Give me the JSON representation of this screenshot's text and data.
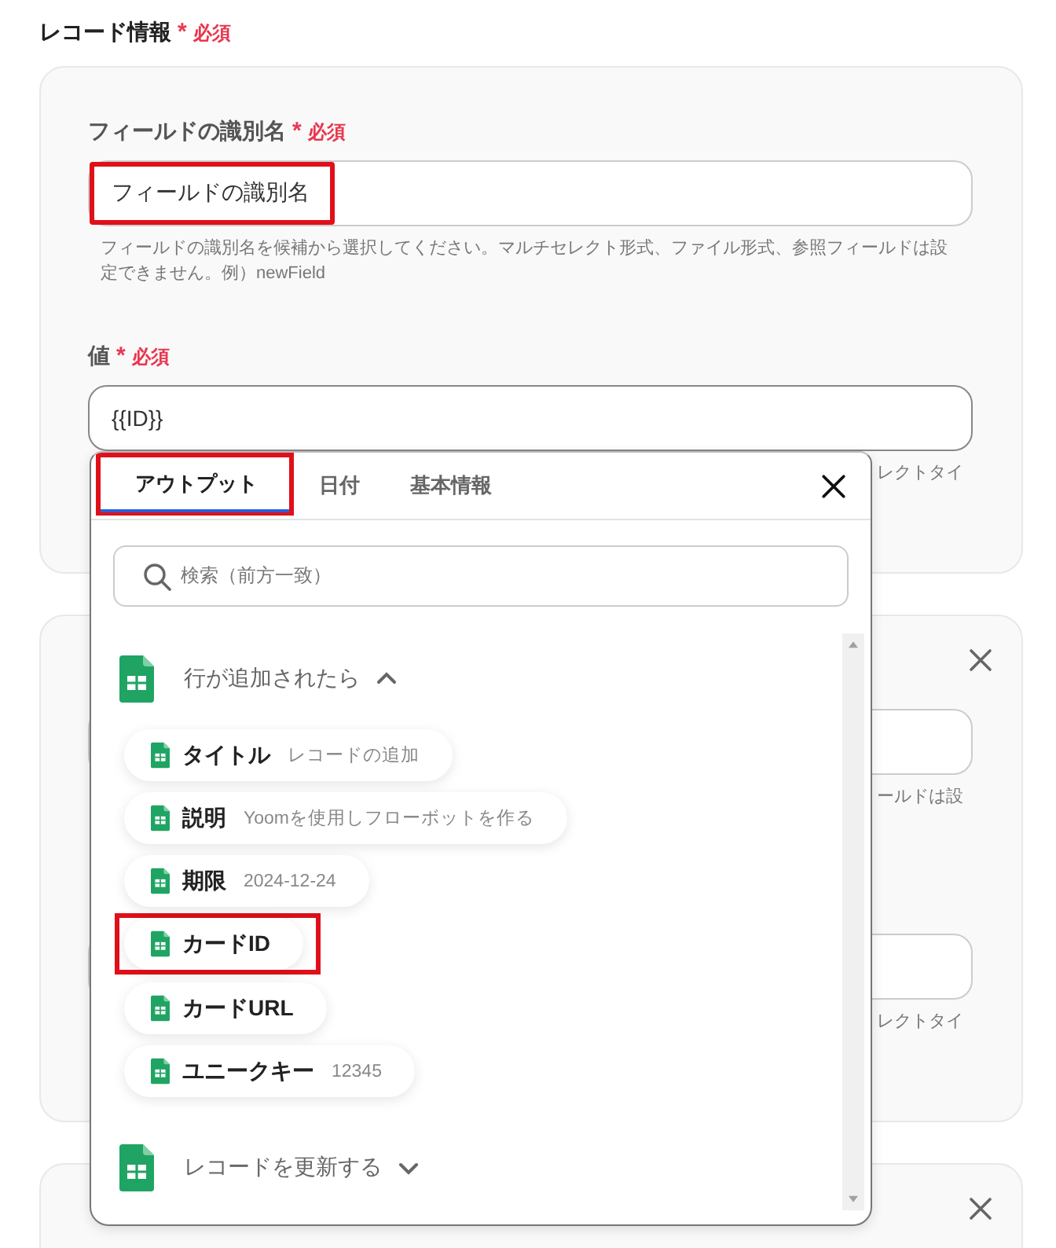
{
  "section_title": {
    "text": "レコード情報",
    "asterisk": "*",
    "required": "必須"
  },
  "cards": [
    {
      "closable": false,
      "fields": [
        {
          "label": "フィールドの識別名",
          "asterisk": "*",
          "required": "必須",
          "value": "フィールドの識別名",
          "highlighted": true,
          "help": "フィールドの識別名を候補から選択してください。マルチセレクト形式、ファイル形式、参照フィールドは設定できません。例）newField"
        },
        {
          "label": "値",
          "asterisk": "*",
          "required": "必須",
          "value": "{{ID}}",
          "help": "レクトタイ"
        }
      ]
    },
    {
      "closable": true,
      "fields": [
        {
          "help": "ールドは設"
        },
        {
          "help": "レクトタイ"
        }
      ]
    },
    {
      "closable": true
    }
  ],
  "picker": {
    "tabs": [
      {
        "label": "アウトプット",
        "selected": true,
        "highlighted": true
      },
      {
        "label": "日付",
        "selected": false,
        "highlighted": false
      },
      {
        "label": "基本情報",
        "selected": false,
        "highlighted": false
      }
    ],
    "search": {
      "placeholder": "検索（前方一致）"
    },
    "groups": [
      {
        "title": "行が追加されたら",
        "expanded": true,
        "items": [
          {
            "name": "タイトル",
            "value": "レコードの追加",
            "highlighted": false
          },
          {
            "name": "説明",
            "value": "Yoomを使用しフローボットを作る",
            "highlighted": false
          },
          {
            "name": "期限",
            "value": "2024-12-24",
            "highlighted": false
          },
          {
            "name": "カードID",
            "highlighted": true
          },
          {
            "name": "カードURL",
            "highlighted": false
          },
          {
            "name": "ユニークキー",
            "value": "12345",
            "highlighted": false
          }
        ]
      },
      {
        "title": "レコードを更新する",
        "expanded": false
      }
    ]
  }
}
